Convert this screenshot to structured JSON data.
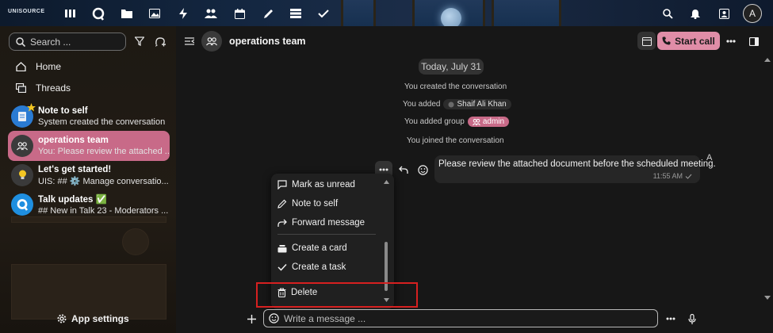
{
  "topbar": {
    "logo": "UNISOURCE",
    "icons": [
      "dashboard-icon",
      "talk-icon",
      "files-icon",
      "photos-icon",
      "activity-icon",
      "contacts-icon",
      "calendar-icon",
      "notes-icon",
      "deck-icon",
      "tasks-icon"
    ],
    "right_icons": [
      "search-icon",
      "notifications-icon",
      "contacts-menu-icon"
    ],
    "avatar_letter": "A"
  },
  "sidebar": {
    "search_placeholder": "Search ...",
    "nav": [
      {
        "label": "Home",
        "icon": "home-icon"
      },
      {
        "label": "Threads",
        "icon": "threads-icon"
      }
    ],
    "conversations": [
      {
        "name": "Note to self",
        "sub": "System created the conversation",
        "icon": "note-icon",
        "favorite": true,
        "active": false
      },
      {
        "name": "operations team",
        "sub": "You: Please review the attached ...",
        "icon": "group-icon",
        "active": true
      },
      {
        "name": "Let's get started!",
        "sub": "UIS: ## ⚙️ Manage conversatio...",
        "icon": "bulb-icon",
        "active": false
      },
      {
        "name": "Talk updates ✅",
        "sub": "## New in Talk 23 - Moderators ...",
        "icon": "talk-updates-icon",
        "active": false
      }
    ],
    "app_settings": "App settings"
  },
  "header": {
    "title": "operations team",
    "start_call": "Start call"
  },
  "chat": {
    "date": "Today, July 31",
    "system": {
      "created": "You created the conversation",
      "added_prefix": "You added",
      "added_user": "Shaif Ali Khan",
      "added_group_prefix": "You added group",
      "added_group": "admin",
      "joined": "You joined the conversation"
    },
    "message": {
      "text": "Please review the attached document before the scheduled meeting.",
      "time": "11:55 AM",
      "author_initial": "A"
    }
  },
  "context_menu": {
    "items": [
      {
        "label": "Mark as unread",
        "icon": "mark-unread-icon"
      },
      {
        "label": "Note to self",
        "icon": "note-to-self-icon"
      },
      {
        "label": "Forward message",
        "icon": "forward-icon"
      },
      {
        "label": "Create a card",
        "icon": "card-icon"
      },
      {
        "label": "Create a task",
        "icon": "task-check-icon"
      },
      {
        "label": "Delete",
        "icon": "trash-icon"
      }
    ]
  },
  "composer": {
    "placeholder": "Write a message ..."
  },
  "colors": {
    "accent": "#c86a88",
    "call_button": "#e08da7",
    "highlight_box": "#d62020"
  }
}
